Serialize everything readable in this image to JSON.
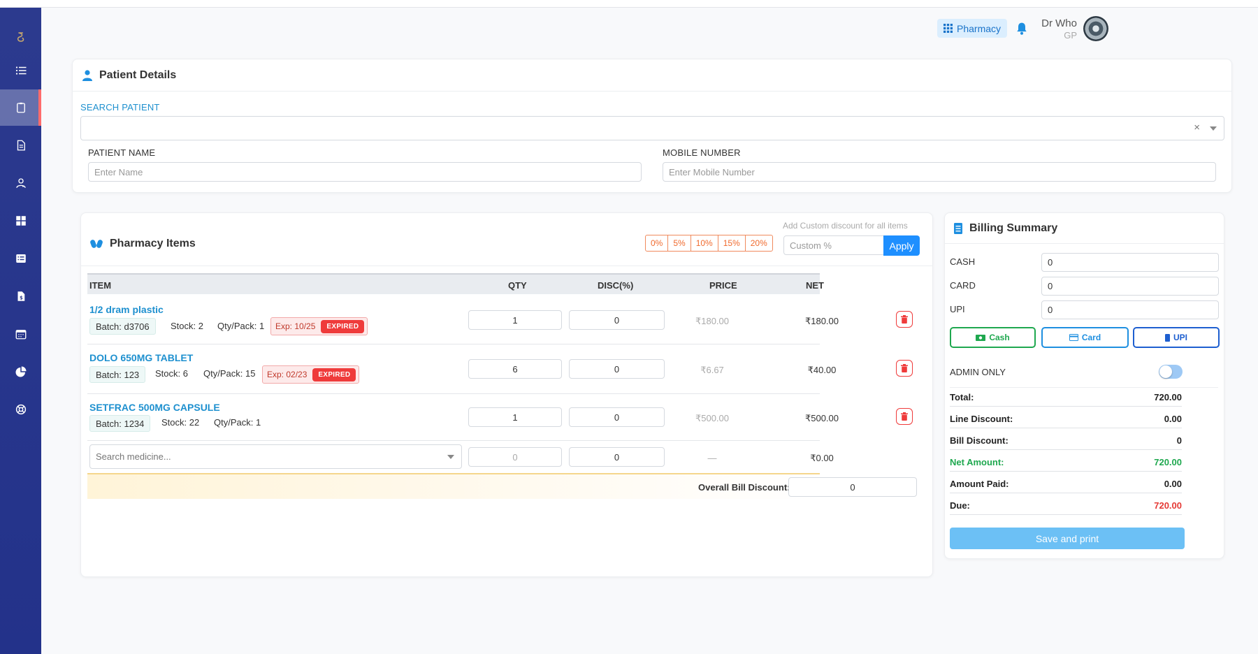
{
  "header": {
    "pharmacy_label": "Pharmacy",
    "user_name": "Dr Who",
    "user_role": "GP"
  },
  "patient": {
    "title": "Patient Details",
    "search_label": "SEARCH PATIENT",
    "clear_symbol": "×",
    "name_label": "PATIENT NAME",
    "name_placeholder": "Enter Name",
    "mobile_label": "MOBILE NUMBER",
    "mobile_placeholder": "Enter Mobile Number"
  },
  "pharmacy": {
    "title": "Pharmacy Items",
    "custom_hint": "Add Custom discount for all items",
    "discount_chips": [
      "0%",
      "5%",
      "10%",
      "15%",
      "20%"
    ],
    "custom_placeholder": "Custom %",
    "apply_label": "Apply",
    "columns": [
      "ITEM",
      "QTY",
      "DISC(%)",
      "PRICE",
      "NET"
    ],
    "items": [
      {
        "name": "1/2 dram plastic",
        "batch": "Batch: d3706",
        "stock": "Stock: 2",
        "qty_pack": "Qty/Pack: 1",
        "exp": "Exp: 10/25",
        "badge": "EXPIRED",
        "qty": "1",
        "disc": "0",
        "price": "₹180.00",
        "net": "₹180.00"
      },
      {
        "name": "DOLO 650MG TABLET",
        "batch": "Batch: 123",
        "stock": "Stock: 6",
        "qty_pack": "Qty/Pack: 15",
        "exp": "Exp: 02/23",
        "badge": "EXPIRED",
        "qty": "6",
        "disc": "0",
        "price": "₹6.67",
        "net": "₹40.00"
      },
      {
        "name": "SETFRAC 500MG CAPSULE",
        "batch": "Batch: 1234",
        "stock": "Stock: 22",
        "qty_pack": "Qty/Pack: 1",
        "qty": "1",
        "disc": "0",
        "price": "₹500.00",
        "net": "₹500.00"
      }
    ],
    "new_row": {
      "search_placeholder": "Search medicine...",
      "qty": "0",
      "disc": "0",
      "price": "—",
      "net": "₹0.00"
    },
    "overall_label": "Overall Bill Discount:",
    "overall_value": "0"
  },
  "billing": {
    "title": "Billing Summary",
    "cash_label": "CASH",
    "cash_value": "0",
    "card_label": "CARD",
    "card_value": "0",
    "upi_label": "UPI",
    "upi_value": "0",
    "btn_cash": "Cash",
    "btn_card": "Card",
    "btn_upi": "UPI",
    "admin_label": "ADMIN ONLY",
    "total_label": "Total:",
    "total_value": "720.00",
    "line_label": "Line Discount:",
    "line_value": "0.00",
    "bill_label": "Bill Discount:",
    "bill_value": "0",
    "net_label": "Net Amount:",
    "net_value": "720.00",
    "paid_label": "Amount Paid:",
    "paid_value": "0.00",
    "due_label": "Due:",
    "due_value": "720.00",
    "save_label": "Save and print"
  },
  "colors": {
    "accent": "#1e90cf",
    "danger": "#ef3b3b",
    "success": "#1fa84f",
    "sidebar": "#2c3a8e"
  }
}
